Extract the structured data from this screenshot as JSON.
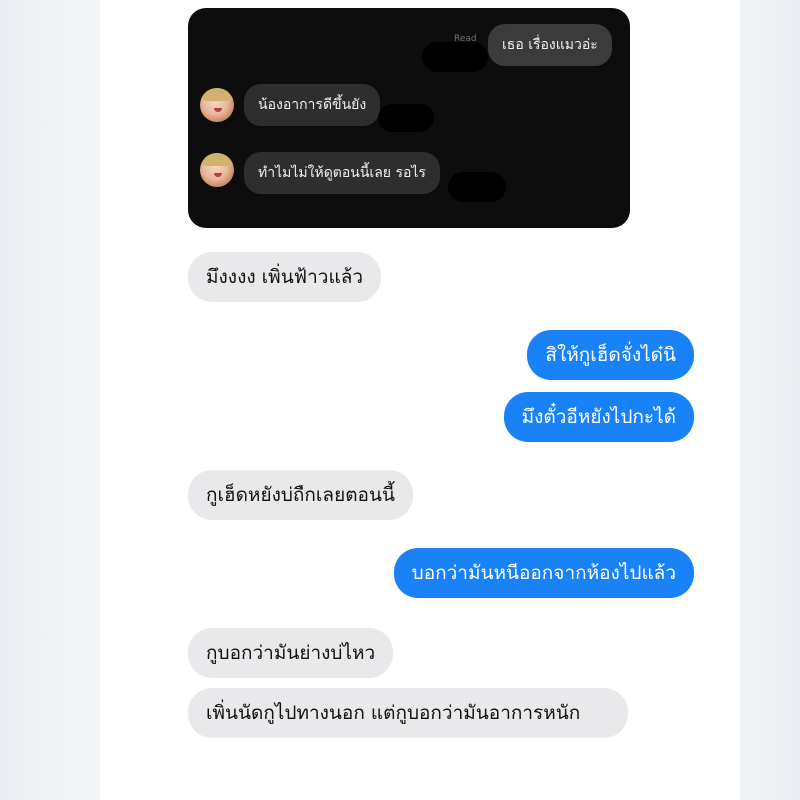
{
  "embedded_screenshot": {
    "read_label": "Read",
    "outgoing": "เธอ เรื่องแมวอ่ะ",
    "incoming": [
      "น้องอาการดีขึ้นยัง",
      "ทำไมไม่ให้ดูตอนนี้เลย รอไร"
    ]
  },
  "messages": [
    {
      "direction": "in",
      "text": "มึงงงง เพิ่นฟ้าวแล้ว"
    },
    {
      "direction": "out",
      "text": "สิให้กูเฮ็ดจั่งได๋นิ"
    },
    {
      "direction": "out",
      "text": "มึงตั๋วอีหยังไปกะได้"
    },
    {
      "direction": "in",
      "text": "กูเฮ็ดหยังบ่ถืกเลยตอนนี้"
    },
    {
      "direction": "out",
      "text": "บอกว่ามันหนีออกจากห้องไปแล้ว"
    },
    {
      "direction": "in",
      "text": "กูบอกว่ามันย่างบ่ไหว"
    },
    {
      "direction": "in",
      "text": "เพิ่นนัดกูไปทางนอก แต่กูบอกว่ามันอาการหนัก"
    }
  ],
  "colors": {
    "outgoing_bubble": "#1a82f7",
    "incoming_bubble": "#e9e9eb",
    "embedded_background": "#0d0d0d",
    "embedded_bubble": "#2e2e2e"
  }
}
